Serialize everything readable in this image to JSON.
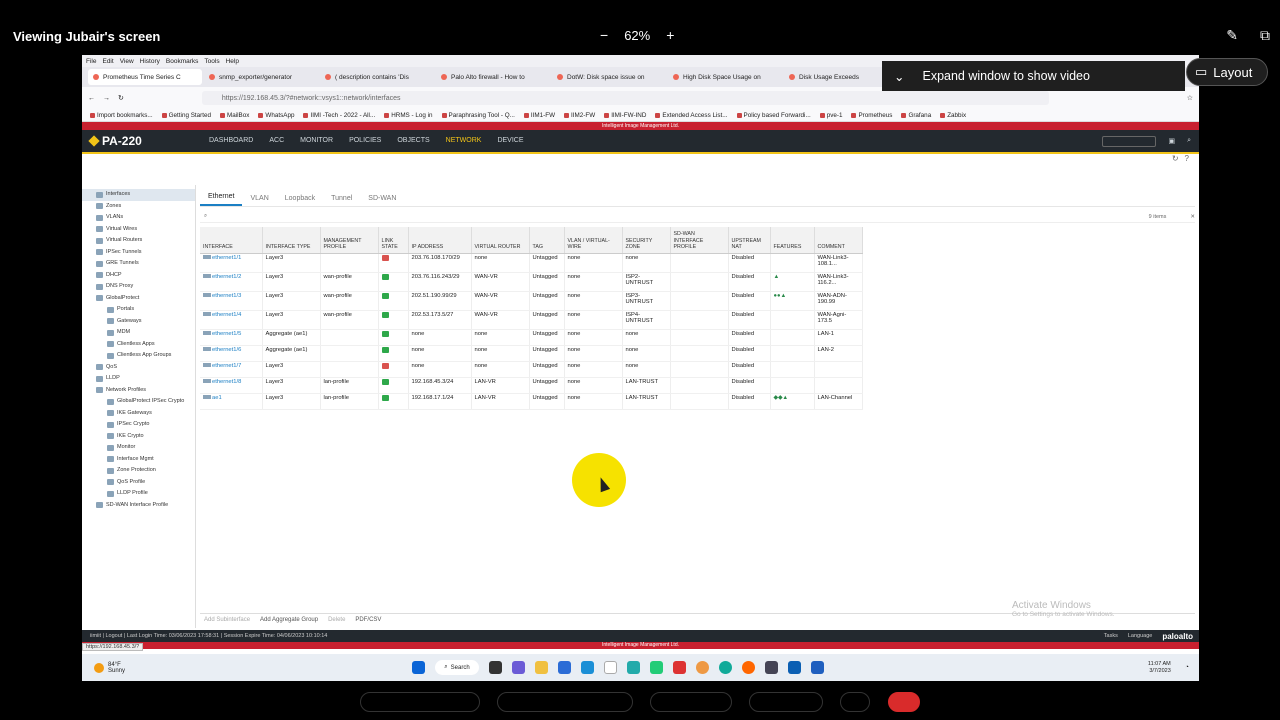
{
  "meeting": {
    "viewing": "Viewing Jubair's screen",
    "zoom": "62%",
    "zoom_minus": "−",
    "zoom_plus": "+",
    "expand_video": "Expand window to show video",
    "layout": "Layout"
  },
  "browser": {
    "menu": [
      "File",
      "Edit",
      "View",
      "History",
      "Bookmarks",
      "Tools",
      "Help"
    ],
    "tabs": [
      {
        "label": "Prometheus Time Series C"
      },
      {
        "label": "snmp_exporter/generator"
      },
      {
        "label": "( description contains 'Dis"
      },
      {
        "label": "Palo Alto firewall - How to"
      },
      {
        "label": "DotW: Disk space issue on"
      },
      {
        "label": "High Disk Space Usage on"
      },
      {
        "label": "Disk Usage Exceeds"
      }
    ],
    "url": "https://192.168.45.3/?#network::vsys1::network/interfaces",
    "bookmarks": [
      "Import bookmarks...",
      "Getting Started",
      "MailBox",
      "WhatsApp",
      "IIMI -Tech - 2022 - All...",
      "HRMS - Log in",
      "Paraphrasing Tool - Q...",
      "IIM1-FW",
      "IIM2-FW",
      "IIMI-FW-IND",
      "Extended Access List...",
      "Policy based Forwardi...",
      "pve-1",
      "Prometheus",
      "Grafana",
      "Zabbix"
    ]
  },
  "banner_top": "Intelligent Image Management Ltd.",
  "panos": {
    "model": "PA-220",
    "nav": [
      {
        "label": "DASHBOARD",
        "active": false
      },
      {
        "label": "ACC",
        "active": false
      },
      {
        "label": "MONITOR",
        "active": false
      },
      {
        "label": "POLICIES",
        "active": false
      },
      {
        "label": "OBJECTS",
        "active": false
      },
      {
        "label": "NETWORK",
        "active": true
      },
      {
        "label": "DEVICE",
        "active": false
      }
    ],
    "commit": "Commit"
  },
  "sidebar": [
    {
      "label": "Interfaces",
      "indent": 0,
      "selected": true
    },
    {
      "label": "Zones",
      "indent": 0
    },
    {
      "label": "VLANs",
      "indent": 0
    },
    {
      "label": "Virtual Wires",
      "indent": 0
    },
    {
      "label": "Virtual Routers",
      "indent": 0
    },
    {
      "label": "IPSec Tunnels",
      "indent": 0
    },
    {
      "label": "GRE Tunnels",
      "indent": 0
    },
    {
      "label": "DHCP",
      "indent": 0
    },
    {
      "label": "DNS Proxy",
      "indent": 0
    },
    {
      "label": "GlobalProtect",
      "indent": 0
    },
    {
      "label": "Portals",
      "indent": 1
    },
    {
      "label": "Gateways",
      "indent": 1
    },
    {
      "label": "MDM",
      "indent": 1
    },
    {
      "label": "Clientless Apps",
      "indent": 1
    },
    {
      "label": "Clientless App Groups",
      "indent": 1
    },
    {
      "label": "QoS",
      "indent": 0
    },
    {
      "label": "LLDP",
      "indent": 0
    },
    {
      "label": "Network Profiles",
      "indent": 0
    },
    {
      "label": "GlobalProtect IPSec Crypto",
      "indent": 1
    },
    {
      "label": "IKE Gateways",
      "indent": 1
    },
    {
      "label": "IPSec Crypto",
      "indent": 1
    },
    {
      "label": "IKE Crypto",
      "indent": 1
    },
    {
      "label": "Monitor",
      "indent": 1
    },
    {
      "label": "Interface Mgmt",
      "indent": 1
    },
    {
      "label": "Zone Protection",
      "indent": 1
    },
    {
      "label": "QoS Profile",
      "indent": 1
    },
    {
      "label": "LLDP Profile",
      "indent": 1
    },
    {
      "label": "SD-WAN Interface Profile",
      "indent": 0
    }
  ],
  "subtabs": [
    {
      "label": "Ethernet",
      "active": true
    },
    {
      "label": "VLAN",
      "active": false
    },
    {
      "label": "Loopback",
      "active": false
    },
    {
      "label": "Tunnel",
      "active": false
    },
    {
      "label": "SD-WAN",
      "active": false
    }
  ],
  "item_count": "9 items",
  "columns": [
    "INTERFACE",
    "INTERFACE TYPE",
    "MANAGEMENT PROFILE",
    "LINK STATE",
    "IP ADDRESS",
    "VIRTUAL ROUTER",
    "TAG",
    "VLAN / VIRTUAL-WIRE",
    "SECURITY ZONE",
    "SD-WAN INTERFACE PROFILE",
    "UPSTREAM NAT",
    "FEATURES",
    "COMMENT"
  ],
  "rows": [
    {
      "interface": "ethernet1/1",
      "type": "Layer3",
      "mgmt": "",
      "link": "down",
      "ip": "203.76.108.170/29",
      "vr": "none",
      "tag": "Untagged",
      "vlan": "none",
      "zone": "none",
      "sdwan": "",
      "nat": "Disabled",
      "features": "",
      "comment": "WAN-Link3-108.1..."
    },
    {
      "interface": "ethernet1/2",
      "type": "Layer3",
      "mgmt": "wan-profile",
      "link": "up",
      "ip": "203.76.116.243/29",
      "vr": "WAN-VR",
      "tag": "Untagged",
      "vlan": "none",
      "zone": "ISP2-UNTRUST",
      "sdwan": "",
      "nat": "Disabled",
      "features": "▲",
      "comment": "WAN-Link3-116.2..."
    },
    {
      "interface": "ethernet1/3",
      "type": "Layer3",
      "mgmt": "wan-profile",
      "link": "up",
      "ip": "202.51.190.99/29",
      "vr": "WAN-VR",
      "tag": "Untagged",
      "vlan": "none",
      "zone": "ISP3-UNTRUST",
      "sdwan": "",
      "nat": "Disabled",
      "features": "●●▲",
      "comment": "WAN-ADN-190.99"
    },
    {
      "interface": "ethernet1/4",
      "type": "Layer3",
      "mgmt": "wan-profile",
      "link": "up",
      "ip": "202.53.173.5/27",
      "vr": "WAN-VR",
      "tag": "Untagged",
      "vlan": "none",
      "zone": "ISP4-UNTRUST",
      "sdwan": "",
      "nat": "Disabled",
      "features": "",
      "comment": "WAN-Agni-173.5"
    },
    {
      "interface": "ethernet1/5",
      "type": "Aggregate (ae1)",
      "mgmt": "",
      "link": "up",
      "ip": "none",
      "vr": "none",
      "tag": "Untagged",
      "vlan": "none",
      "zone": "none",
      "sdwan": "",
      "nat": "Disabled",
      "features": "",
      "comment": "LAN-1"
    },
    {
      "interface": "ethernet1/6",
      "type": "Aggregate (ae1)",
      "mgmt": "",
      "link": "up",
      "ip": "none",
      "vr": "none",
      "tag": "Untagged",
      "vlan": "none",
      "zone": "none",
      "sdwan": "",
      "nat": "Disabled",
      "features": "",
      "comment": "LAN-2"
    },
    {
      "interface": "ethernet1/7",
      "type": "Layer3",
      "mgmt": "",
      "link": "down",
      "ip": "none",
      "vr": "none",
      "tag": "Untagged",
      "vlan": "none",
      "zone": "none",
      "sdwan": "",
      "nat": "Disabled",
      "features": "",
      "comment": ""
    },
    {
      "interface": "ethernet1/8",
      "type": "Layer3",
      "mgmt": "lan-profile",
      "link": "up",
      "ip": "192.168.45.3/24",
      "vr": "LAN-VR",
      "tag": "Untagged",
      "vlan": "none",
      "zone": "LAN-TRUST",
      "sdwan": "",
      "nat": "Disabled",
      "features": "",
      "comment": ""
    },
    {
      "interface": "ae1",
      "type": "Layer3",
      "mgmt": "lan-profile",
      "link": "up",
      "ip": "192.168.17.1/24",
      "vr": "LAN-VR",
      "tag": "Untagged",
      "vlan": "none",
      "zone": "LAN-TRUST",
      "sdwan": "",
      "nat": "Disabled",
      "features": "◆◆▲",
      "comment": "LAN-Channel"
    }
  ],
  "bottom_actions": [
    "Add Subinterface",
    "Add Aggregate Group",
    "Delete",
    "PDF/CSV"
  ],
  "watermark": {
    "title": "Activate Windows",
    "sub": "Go to Settings to activate Windows."
  },
  "statusbar": {
    "user": "iimiit",
    "logout": "Logout",
    "last_login": "Last Login Time: 03/06/2023 17:58:31",
    "expire": "Session Expire Time: 04/06/2023 10:10:14",
    "tasks": "Tasks",
    "language": "Language",
    "brand": "paloalto"
  },
  "banner_bottom": "Intelligent Image Management Ltd.",
  "url_hint": "https://192.168.45.3/?",
  "taskbar": {
    "temp": "84°F",
    "weather": "Sunny",
    "search": "Search",
    "time": "11:07 AM",
    "date": "3/7/2023"
  }
}
